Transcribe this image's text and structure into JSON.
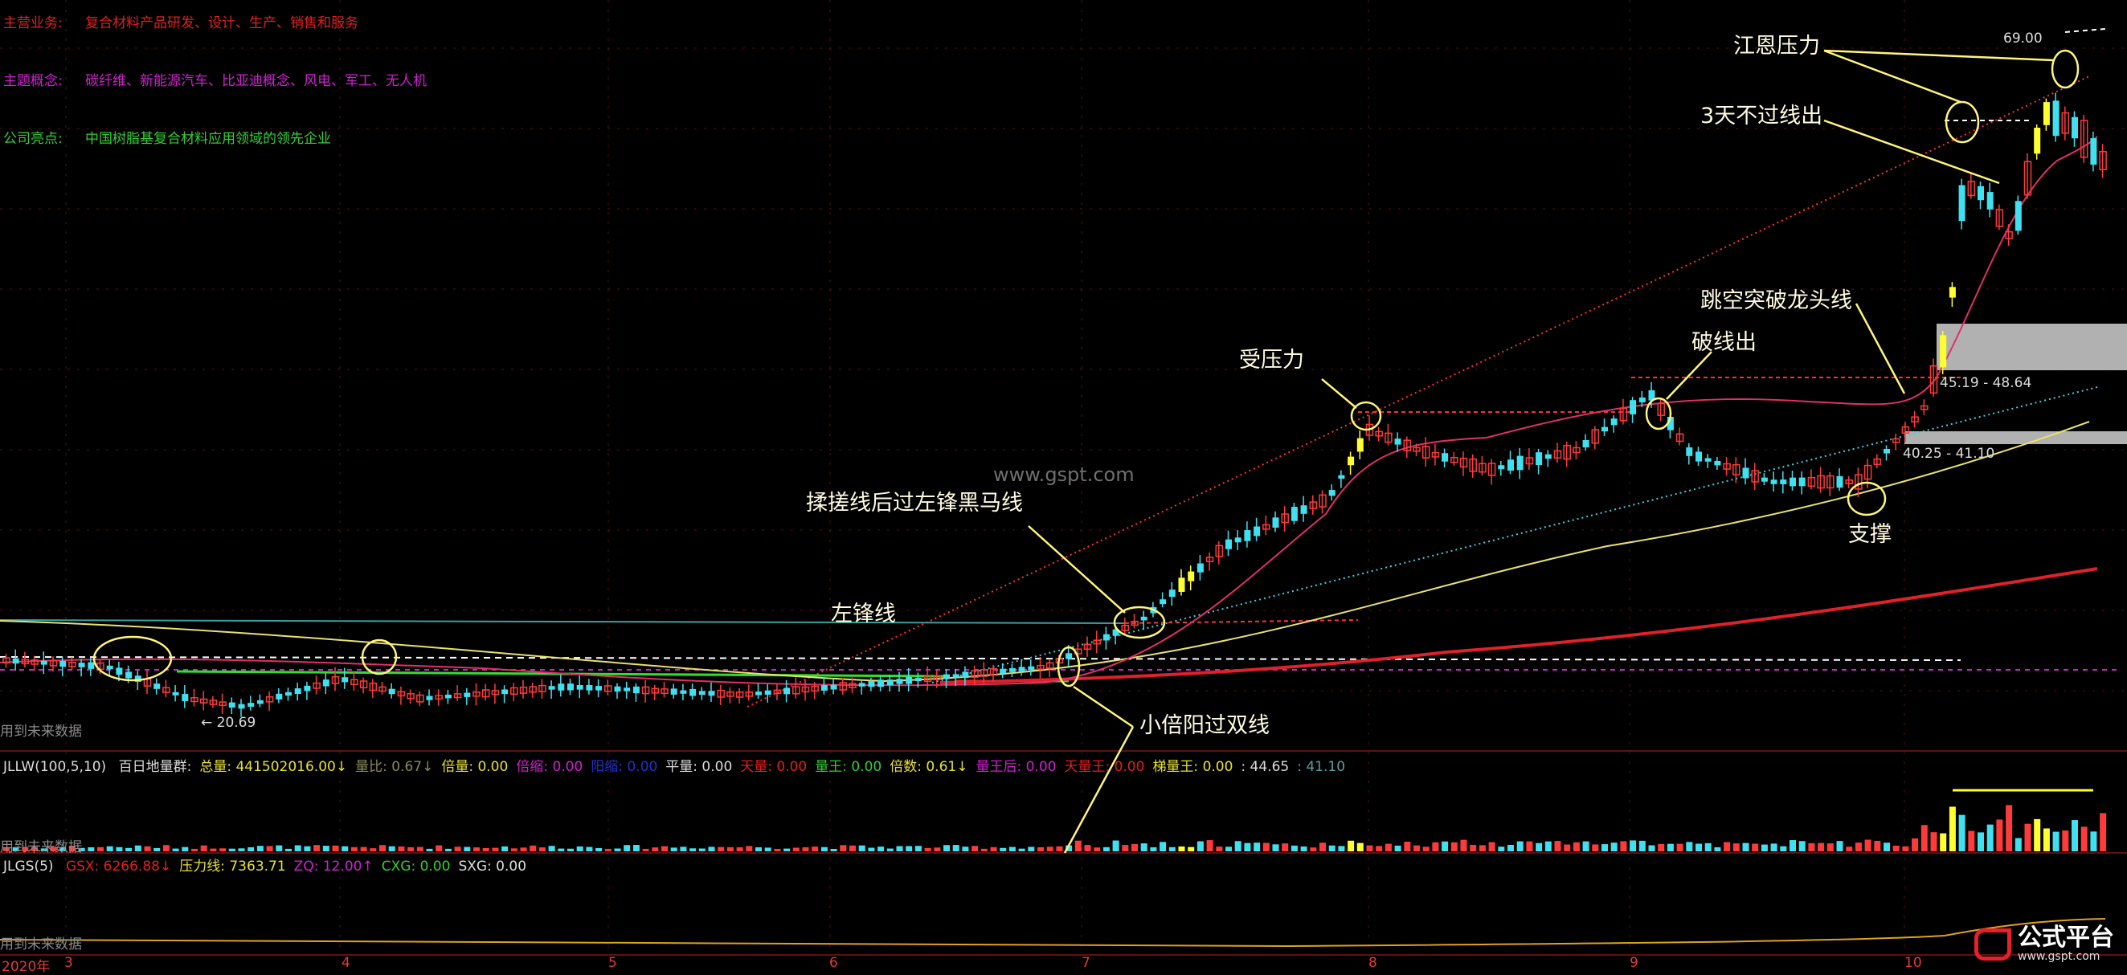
{
  "info": {
    "business_label": "主营业务:",
    "business_value": "复合材料产品研发、设计、生产、销售和服务",
    "concept_label": "主题概念:",
    "concept_value": "碳纤维、新能源汽车、比亚迪概念、风电、军工、无人机",
    "highlight_label": "公司亮点:",
    "highlight_value": "中国树脂基复合材料应用领域的领先企业"
  },
  "annotations": {
    "jiangen": "江恩压力",
    "three_days": "3天不过线出",
    "gap_break": "跳空突破龙头线",
    "break_out": "破线出",
    "pressure": "受压力",
    "rub_line": "揉搓线后过左锋黑马线",
    "left_peak": "左锋线",
    "small_yang": "小倍阳过双线",
    "support": "支撑"
  },
  "price_labels": {
    "high": "69.00",
    "zone_upper": "45.19 - 48.64",
    "zone_lower": "40.25 - 41.10",
    "low": "← 20.69"
  },
  "future_data": "用到未来数据",
  "watermark": "www.gspt.com",
  "indicator1": {
    "name": "JLLW(100,5,10)",
    "items": [
      {
        "text": "百日地量群:",
        "color": "#dddddd"
      },
      {
        "text": "总量: 441502016.00↓",
        "color": "#e8e030"
      },
      {
        "text": "量比: 0.67↓",
        "color": "#8a8a5a"
      },
      {
        "text": "倍量: 0.00",
        "color": "#e8e030"
      },
      {
        "text": "倍缩: 0.00",
        "color": "#d020d0"
      },
      {
        "text": "阳缩: 0.00",
        "color": "#2030d0"
      },
      {
        "text": "平量: 0.00",
        "color": "#dddddd"
      },
      {
        "text": "天量: 0.00",
        "color": "#e02020"
      },
      {
        "text": "量王: 0.00",
        "color": "#30d030"
      },
      {
        "text": "倍数: 0.61↓",
        "color": "#e8e030"
      },
      {
        "text": "量王后: 0.00",
        "color": "#d020d0"
      },
      {
        "text": "天量王: 0.00",
        "color": "#e02020"
      },
      {
        "text": "梯量王: 0.00",
        "color": "#e8e030"
      },
      {
        "text": ": 44.65",
        "color": "#dddddd"
      },
      {
        "text": ": 41.10",
        "color": "#5aa0a0"
      }
    ]
  },
  "indicator2": {
    "name": "JLGS(5)",
    "items": [
      {
        "text": "GSX: 6266.88↓",
        "color": "#e02020"
      },
      {
        "text": "压力线: 7363.71",
        "color": "#e8e030"
      },
      {
        "text": "ZQ: 12.00↑",
        "color": "#d020d0"
      },
      {
        "text": "CXG: 0.00",
        "color": "#30d030"
      },
      {
        "text": "SXG: 0.00",
        "color": "#dddddd"
      }
    ]
  },
  "x_axis": {
    "year": "2020年",
    "months": [
      "3",
      "4",
      "5",
      "6",
      "7",
      "8",
      "9",
      "10"
    ]
  },
  "logo": {
    "text": "公式平台",
    "sub": "www.gspt.com"
  },
  "colors": {
    "up": "#ff3a3a",
    "down": "#40e0f0",
    "yellow": "#ffff30",
    "ma_red": "#e0202a",
    "ma_yellow": "#e8e070",
    "ma_pink": "#e0306a"
  },
  "chart_data": {
    "type": "candlestick",
    "description_of_points": "approximate closing price path (data units, read off labeled levels 20.69 low and 69.00 high)",
    "x": [
      "2020-03",
      "2020-04",
      "2020-05",
      "2020-06",
      "2020-07",
      "2020-08",
      "2020-09",
      "2020-10"
    ],
    "close_approx": [
      27.5,
      22.0,
      24.0,
      23.5,
      28.0,
      44.0,
      41.0,
      58.0
    ],
    "high": 69.0,
    "low": 20.69,
    "zones": [
      [
        45.19,
        48.64
      ],
      [
        40.25,
        41.1
      ]
    ]
  }
}
